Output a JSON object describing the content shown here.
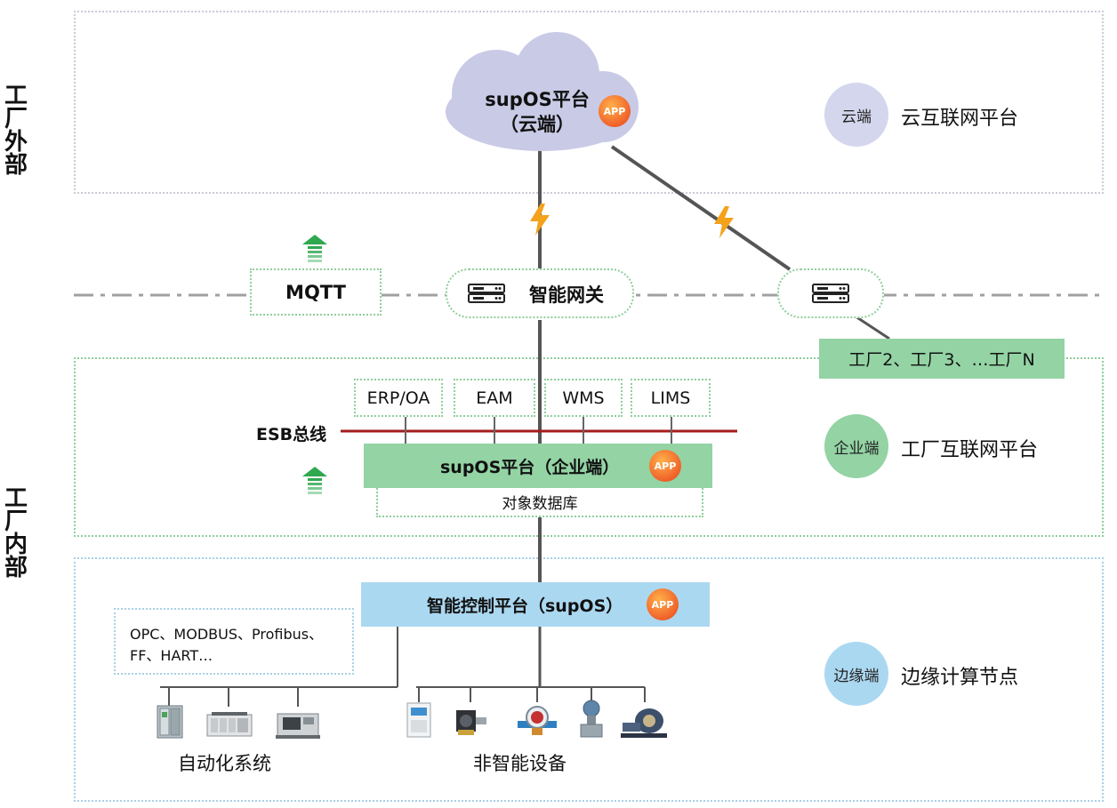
{
  "side_labels": {
    "outside": [
      "工",
      "厂",
      "外",
      "部"
    ],
    "inside": [
      "工",
      "厂",
      "内",
      "部"
    ]
  },
  "cloud": {
    "title_line1": "supOS平台",
    "title_line2": "（云端）",
    "app": "APP"
  },
  "cloud_layer": {
    "circle": "云端",
    "label": "云互联网平台"
  },
  "mqtt": "MQTT",
  "gateway": "智能网关",
  "other_factories": "工厂2、工厂3、…工厂N",
  "systems": [
    "ERP/OA",
    "EAM",
    "WMS",
    "LIMS"
  ],
  "esb": "ESB总线",
  "enterprise_platform": {
    "label": "supOS平台（企业端）",
    "app": "APP"
  },
  "object_db": "对象数据库",
  "enterprise_layer": {
    "circle": "企业端",
    "label": "工厂互联网平台"
  },
  "control_platform": {
    "label": "智能控制平台（supOS）",
    "app": "APP"
  },
  "protocols": {
    "line1": "OPC、MODBUS、Profibus、",
    "line2": "FF、HART…"
  },
  "edge_layer": {
    "circle": "边缘端",
    "label": "边缘计算节点"
  },
  "automation_systems": "自动化系统",
  "non_smart_devices": "非智能设备",
  "colors": {
    "green": "#93d3a4",
    "blue": "#abd8f1",
    "cloud": "#c8cae6",
    "lavender": "#d4d6ee",
    "esb": "#a31c1c",
    "bolt": "#f4a21c"
  }
}
